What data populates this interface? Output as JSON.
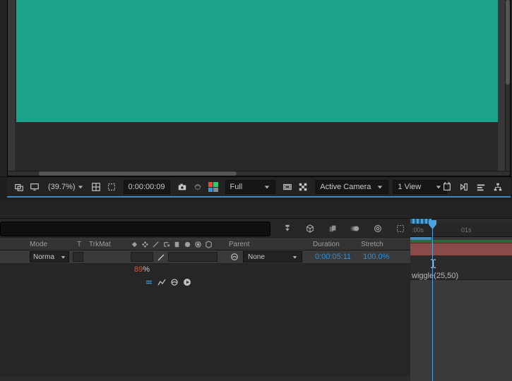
{
  "viewer": {
    "magnification": "(39.7%)",
    "timecode": "0:00:00:09",
    "resolution": "Full",
    "camera": "Active Camera",
    "view": "1 View"
  },
  "timeline": {
    "ruler": {
      "firstLabel": ":00s",
      "secondLabel": "01s"
    },
    "columns": {
      "mode": "Mode",
      "t": "T",
      "trkmat": "TrkMat",
      "parent": "Parent",
      "duration": "Duration",
      "stretch": "Stretch"
    },
    "layer": {
      "modeSelected": "Norma",
      "parentSelected": "None",
      "duration": "0:00:05:11",
      "stretch": "100.0%"
    },
    "value": {
      "number": "89",
      "percent": "%"
    },
    "expression": "wiggle(25,50)"
  }
}
